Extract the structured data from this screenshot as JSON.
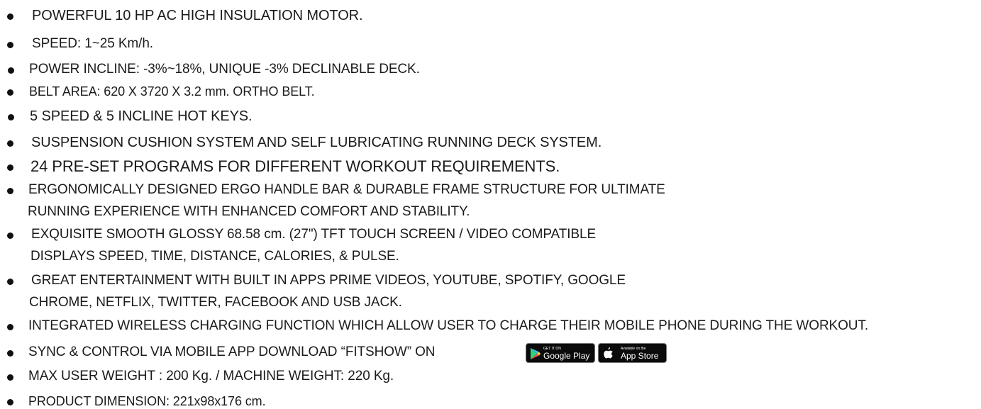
{
  "features": [
    {
      "lines": [
        "POWERFUL 10 HP AC HIGH INSULATION MOTOR."
      ]
    },
    {
      "lines": [
        "SPEED: 1~25 Km/h."
      ]
    },
    {
      "lines": [
        "POWER INCLINE: -3%~18%, UNIQUE -3% DECLINABLE DECK."
      ]
    },
    {
      "lines": [
        "BELT AREA: 620 X 3720 X 3.2 mm. ORTHO BELT."
      ]
    },
    {
      "lines": [
        "5 SPEED & 5 INCLINE HOT KEYS."
      ]
    },
    {
      "lines": [
        "SUSPENSION CUSHION SYSTEM AND SELF LUBRICATING RUNNING DECK SYSTEM."
      ]
    },
    {
      "lines": [
        "24 PRE-SET PROGRAMS FOR DIFFERENT WORKOUT REQUIREMENTS."
      ]
    },
    {
      "lines": [
        "ERGONOMICALLY DESIGNED ERGO HANDLE BAR & DURABLE FRAME STRUCTURE FOR ULTIMATE",
        "RUNNING EXPERIENCE WITH ENHANCED COMFORT AND STABILITY."
      ]
    },
    {
      "lines": [
        "EXQUISITE SMOOTH GLOSSY 68.58 cm. (27\") TFT TOUCH SCREEN / VIDEO COMPATIBLE",
        "DISPLAYS  SPEED, TIME, DISTANCE, CALORIES, & PULSE."
      ]
    },
    {
      "lines": [
        "GREAT ENTERTAINMENT WITH BUILT IN APPS  PRIME VIDEOS, YOUTUBE, SPOTIFY, GOOGLE",
        "CHROME, NETFLIX, TWITTER, FACEBOOK AND USB JACK."
      ]
    },
    {
      "lines": [
        "INTEGRATED WIRELESS CHARGING FUNCTION WHICH ALLOW USER TO CHARGE THEIR MOBILE PHONE DURING THE WORKOUT."
      ]
    },
    {
      "lines": [
        "SYNC & CONTROL VIA MOBILE APP DOWNLOAD “FITSHOW” ON"
      ]
    },
    {
      "lines": [
        "MAX USER WEIGHT : 200 Kg. / MACHINE WEIGHT: 220 Kg."
      ]
    },
    {
      "lines": [
        "PRODUCT DIMENSION: 221x98x176 cm."
      ]
    }
  ],
  "store_badges": {
    "google_play": {
      "small": "GET IT ON",
      "big": "Google Play",
      "icon": "google-play-icon"
    },
    "app_store": {
      "small": "Available on the",
      "big": "App Store",
      "icon": "apple-icon"
    }
  }
}
